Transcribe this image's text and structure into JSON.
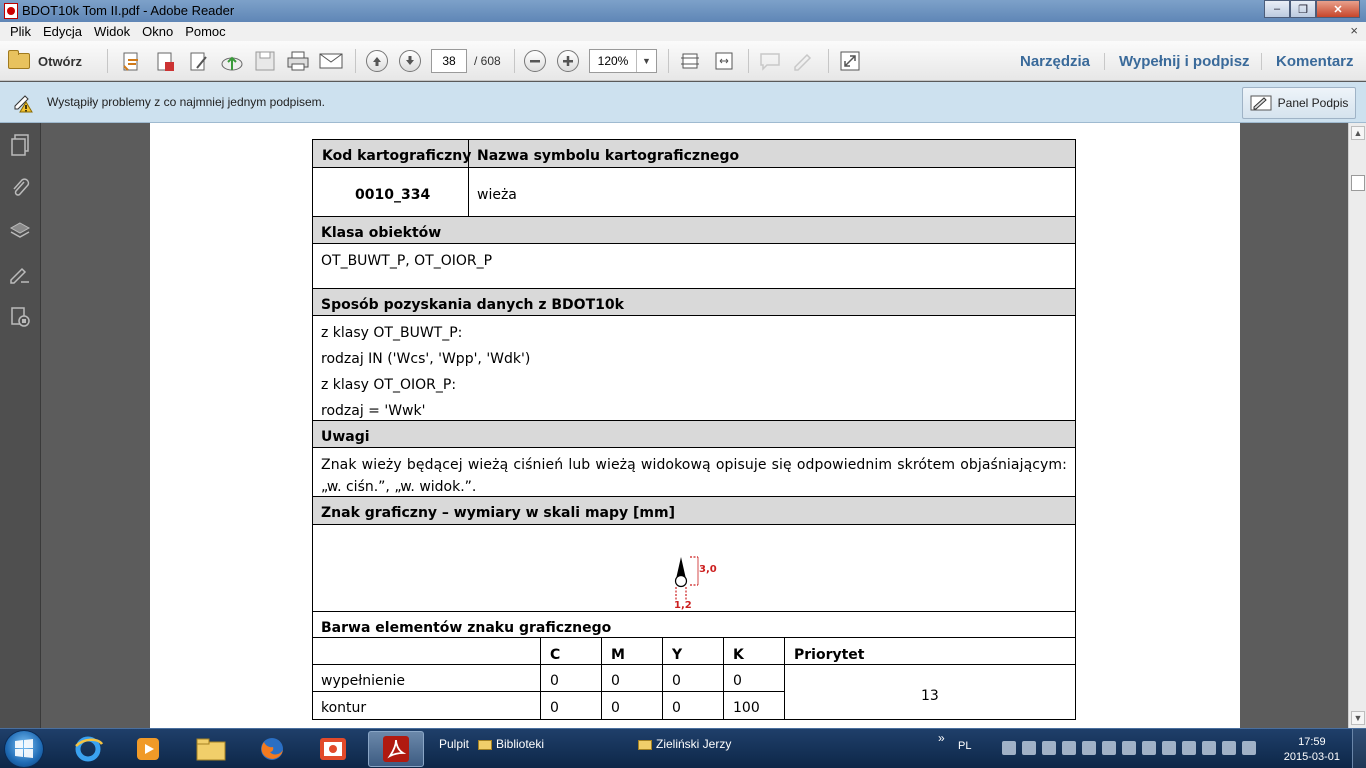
{
  "window": {
    "title": "BDOT10k Tom II.pdf - Adobe Reader",
    "minimize": "–",
    "maximize": "❐",
    "close": "✕"
  },
  "menu": {
    "items": [
      "Plik",
      "Edycja",
      "Widok",
      "Okno",
      "Pomoc"
    ],
    "close": "×"
  },
  "toolbar": {
    "open_label": "Otwórz",
    "page_current": "38",
    "page_total": "/ 608",
    "zoom": "120%",
    "tools": "Narzędzia",
    "fill_sign": "Wypełnij i podpisz",
    "comment": "Komentarz"
  },
  "notice": {
    "message": "Wystąpiły problemy z co najmniej jednym podpisem.",
    "panel_button": "Panel Podpis"
  },
  "document": {
    "col_code_header": "Kod kartograficzny",
    "col_name_header": "Nazwa symbolu kartograficznego",
    "code": "0010_334",
    "name": "wieża",
    "class_header": "Klasa obiektów",
    "class_value": "OT_BUWT_P, OT_OIOR_P",
    "method_header": "Sposób pozyskania danych z BDOT10k",
    "method_lines": [
      "z klasy OT_BUWT_P:",
      "rodzaj IN ('Wcs', 'Wpp', 'Wdk')",
      "z klasy OT_OIOR_P:",
      "rodzaj = 'Wwk'"
    ],
    "notes_header": "Uwagi",
    "notes_line1": "Znak wieży będącej wieżą ciśnień lub wieżą widokową opisuje się odpowiednim skrótem objaśniającym:",
    "notes_line2": "„w. ciśn.”, „w. widok.”.",
    "sign_header": "Znak graficzny – wymiary w skali mapy [mm]",
    "dim_height": "3,0",
    "dim_width": "1,2",
    "colors_header": "Barwa elementów znaku graficznego",
    "color_cols": [
      "C",
      "M",
      "Y",
      "K"
    ],
    "priority_header": "Priorytet",
    "rows": [
      {
        "label": "wypełnienie",
        "c": "0",
        "m": "0",
        "y": "0",
        "k": "0"
      },
      {
        "label": "kontur",
        "c": "0",
        "m": "0",
        "y": "0",
        "k": "100"
      }
    ],
    "priority": "13"
  },
  "taskbar": {
    "desktop": "Pulpit",
    "libraries": "Biblioteki",
    "user": "Zieliński Jerzy",
    "lang": "PL",
    "time": "17:59",
    "date": "2015-03-01",
    "expand": "»"
  },
  "colors": {
    "dimension_red": "#cc1f1f",
    "link_blue": "#3a6a9a"
  }
}
